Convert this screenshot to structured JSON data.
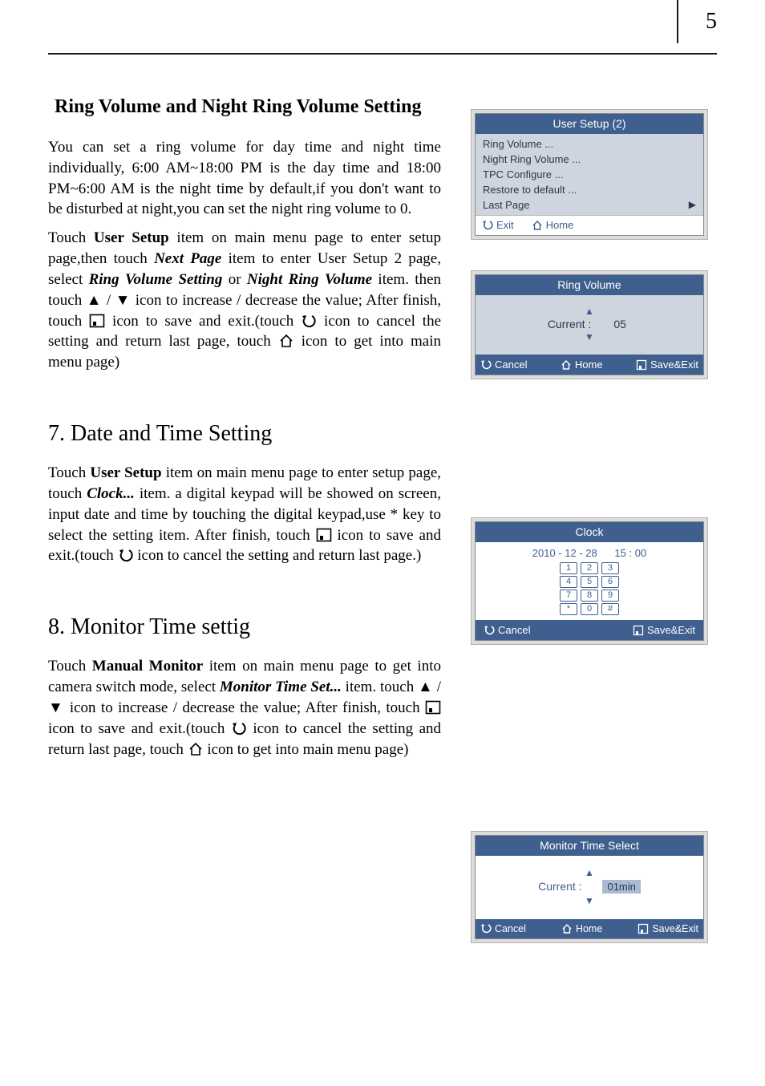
{
  "page_number": "5",
  "section1": {
    "title": "Ring Volume and Night Ring Volume Setting",
    "p1_a": "You can set a ring volume for day time and night time individually, 6:00 AM~18:00 PM is the day time and 18:00 PM~6:00 AM is the night time by default,if you don't want to be disturbed at night,you can set the night ring volume to 0.",
    "p2_a": "Touch ",
    "p2_b": "User Setup",
    "p2_c": " item on main menu page to enter setup page,then touch ",
    "p2_d": "Next Page",
    "p2_e": " item to enter User Setup 2 page, select ",
    "p2_f": "Ring Volume Setting",
    "p2_g": " or ",
    "p2_h": "Night Ring Volume",
    "p2_i": " item.  then touch ▲ / ▼ icon to increase / decrease the value;  After finish, touch ",
    "p2_j": " icon to save and exit.(touch ",
    "p2_k": " icon to cancel the setting and return last page, touch ",
    "p2_l": " icon to get into main menu page)"
  },
  "section2": {
    "title": "7. Date and Time Setting",
    "p_a": "Touch ",
    "p_b": "User Setup",
    "p_c": " item on main menu page to enter setup page, touch ",
    "p_d": "Clock...",
    "p_e": " item. a digital keypad will be showed on screen, input date and time by touching the digital keypad,use * key to select the setting item. After finish, touch ",
    "p_f": "  icon to save and exit.(touch ",
    "p_g": " icon to cancel the setting and return last page.)"
  },
  "section3": {
    "title": "8. Monitor Time settig",
    "p_a": "Touch ",
    "p_b": "Manual Monitor",
    "p_c": " item on main menu page to get into camera switch mode, select ",
    "p_d": "Monitor Time Set...",
    "p_e": " item. touch ▲ / ▼ icon to increase / decrease the value;  After finish, touch ",
    "p_f": "  icon to save and exit.(touch ",
    "p_g": " icon to cancel the setting and return last page, touch ",
    "p_h": " icon to get into main menu page)"
  },
  "device_user_setup": {
    "title": "User Setup  (2)",
    "items": [
      "Ring Volume  ...",
      "Night Ring Volume  ...",
      "TPC Configure  ...",
      "Restore to default  ...",
      "Last Page"
    ],
    "foot_exit": "Exit",
    "foot_home": "Home"
  },
  "device_ring_volume": {
    "title": "Ring Volume",
    "label": "Current :",
    "value": "05",
    "foot_cancel": "Cancel",
    "foot_home": "Home",
    "foot_save": "Save&Exit"
  },
  "device_clock": {
    "title": "Clock",
    "date": "2010 - 12 - 28",
    "time": "15 : 00",
    "keys": [
      [
        "1",
        "2",
        "3"
      ],
      [
        "4",
        "5",
        "6"
      ],
      [
        "7",
        "8",
        "9"
      ],
      [
        "*",
        "0",
        "#"
      ]
    ],
    "foot_cancel": "Cancel",
    "foot_save": "Save&Exit"
  },
  "device_monitor": {
    "title": "Monitor Time Select",
    "label": "Current :",
    "value": "01min",
    "foot_cancel": "Cancel",
    "foot_home": "Home",
    "foot_save": "Save&Exit"
  }
}
